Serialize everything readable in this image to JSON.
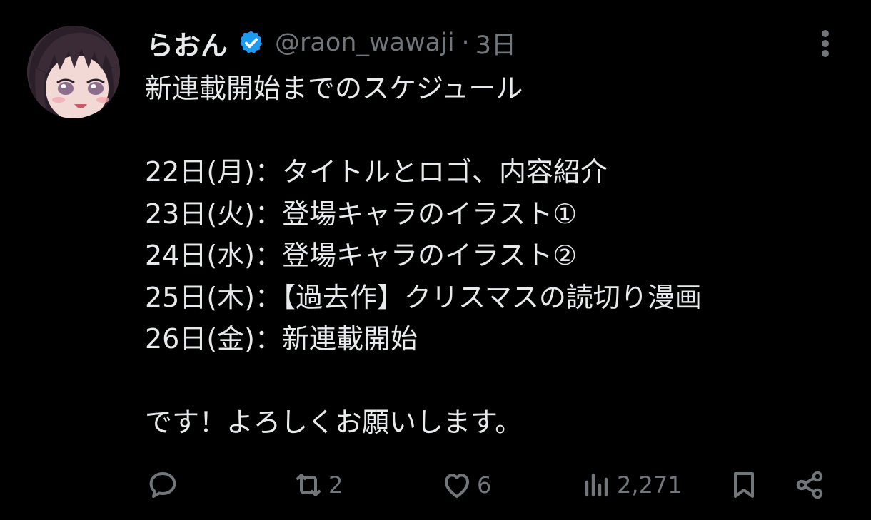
{
  "tweet": {
    "author": {
      "display_name": "らおん",
      "handle": "@raon_wawaji",
      "verified": true
    },
    "separator": "·",
    "time": "3日",
    "text_lines": [
      "新連載開始までのスケジュール",
      "",
      "22日(月)：タイトルとロゴ、内容紹介",
      "23日(火)：登場キャラのイラスト①",
      "24日(水)：登場キャラのイラスト②",
      "25日(木)：【過去作】クリスマスの読切り漫画",
      "26日(金)：新連載開始",
      "",
      "です！よろしくお願いします。"
    ]
  },
  "actions": {
    "reply": {
      "icon": "reply-icon",
      "count": ""
    },
    "repost": {
      "icon": "repost-icon",
      "count": "2"
    },
    "like": {
      "icon": "heart-icon",
      "count": "6"
    },
    "views": {
      "icon": "views-icon",
      "count": "2,271"
    },
    "bookmark": {
      "icon": "bookmark-icon"
    },
    "share": {
      "icon": "share-icon"
    }
  },
  "colors": {
    "background": "#000000",
    "text": "#e7e9ea",
    "secondary": "#71767b",
    "verified": "#1d9bf0"
  }
}
